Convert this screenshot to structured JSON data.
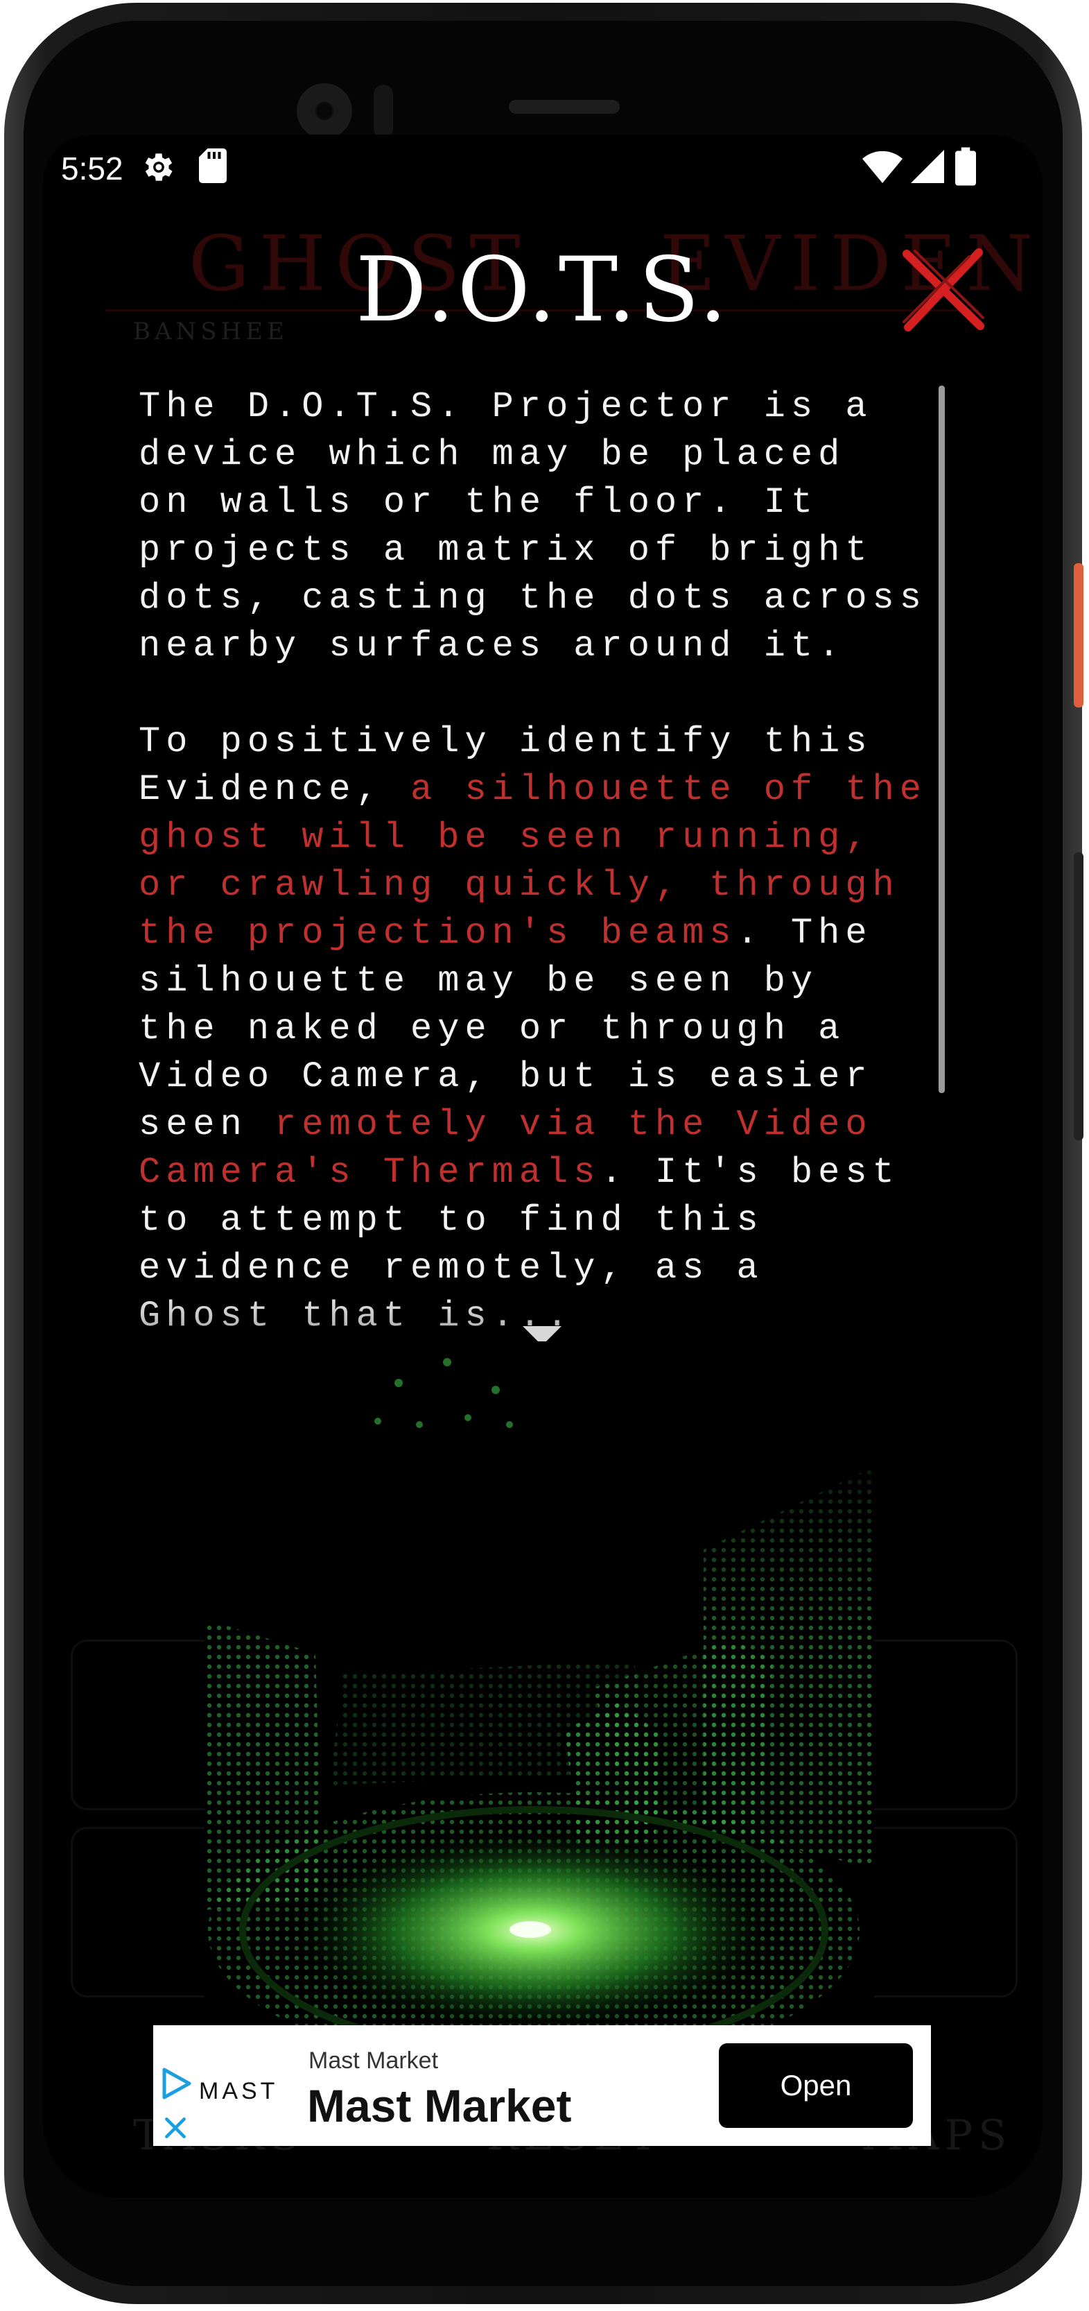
{
  "status_bar": {
    "time": "5:52"
  },
  "background": {
    "title_left": "GHOST",
    "title_right": "EVIDENCE",
    "ghost_label": "BANSHEE",
    "nav_items": [
      "TASKS",
      "RESET",
      "MAPS"
    ]
  },
  "dialog": {
    "title": "D.O.T.S.",
    "paragraphs": [
      [
        {
          "text": "The D.O.T.S. Projector is a\ndevice which may be placed\non walls or the floor. It\nprojects a matrix of bright\ndots, casting the dots across\nnearby surfaces around it.",
          "highlight": false
        }
      ],
      [
        {
          "text": "To positively identify this\nEvidence, ",
          "highlight": false
        },
        {
          "text": "a silhouette of the\nghost will be seen running,\nor crawling quickly, through\nthe projection's beams",
          "highlight": true
        },
        {
          "text": ". The\nsilhouette may be seen by\nthe naked eye or through a\nVideo Camera, but is easier\nseen ",
          "highlight": false
        },
        {
          "text": "remotely via the Video\nCamera's Thermals",
          "highlight": true
        },
        {
          "text": ". It's best\nto attempt to find this\nevidence remotely, as a\nGhost that is...",
          "highlight": false
        }
      ]
    ]
  },
  "ad": {
    "brand_logo_text": "MAST",
    "advertiser_small": "Mast Market",
    "advertiser_big": "Mast Market",
    "cta_label": "Open"
  },
  "colors": {
    "highlight": "#c0302e",
    "close_x": "#d42020",
    "background": "#000000"
  }
}
